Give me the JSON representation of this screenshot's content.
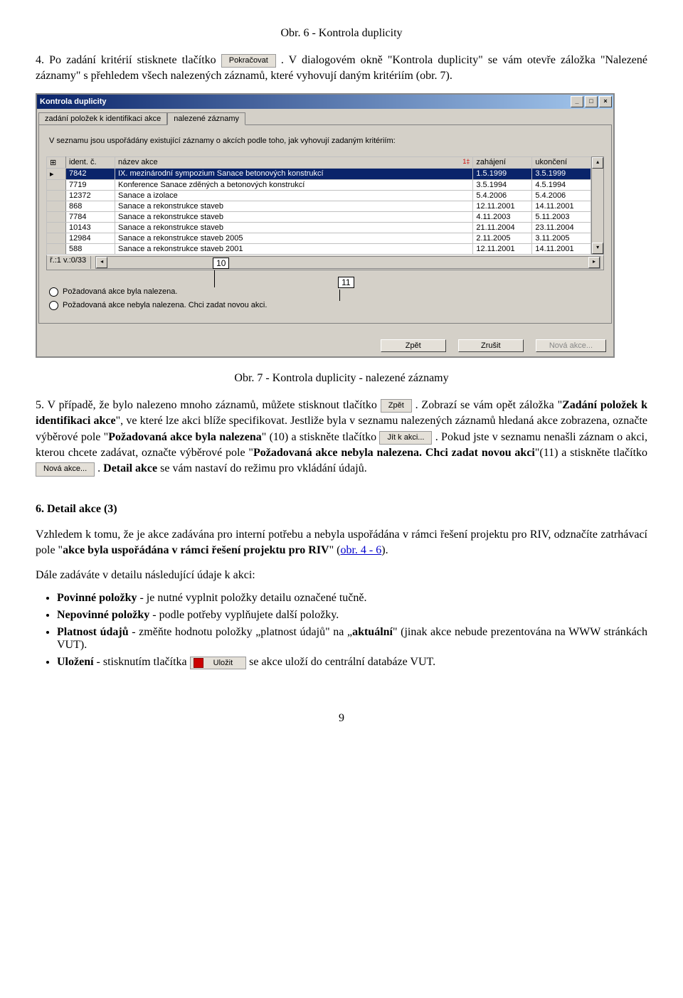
{
  "fig6_caption": "Obr. 6 - Kontrola duplicity",
  "para4_prefix": "4. Po zadání kritérií stisknete tlačítko ",
  "btn_pokracovat": "Pokračovat",
  "para4_suffix": ". V dialogovém okně \"Kontrola duplicity\" se vám otevře záložka \"Nalezené záznamy\" s přehledem všech nalezených záznamů, které vyhovují daným kritériím (obr. 7).",
  "dialog": {
    "title": "Kontrola duplicity",
    "min": "_",
    "max": "□",
    "close": "×",
    "tab1": "zadání položek k identifikaci akce",
    "tab2": "nalezené záznamy",
    "intro": "V seznamu jsou uspořádány existující záznamy o akcích podle toho, jak vyhovují zadaným kritériím:",
    "expand": "⊞",
    "headers": {
      "id": "ident. č.",
      "name": "název akce",
      "start": "zahájení",
      "end": "ukončení"
    },
    "sortmark": "1‡",
    "rows": [
      {
        "sel": "▸",
        "id": "7842",
        "name": "IX. mezinárodní sympozium Sanace betonových konstrukcí",
        "start": "1.5.1999",
        "end": "3.5.1999",
        "selected": true
      },
      {
        "sel": "",
        "id": "7719",
        "name": "Konference Sanace zděných a betonových konstrukcí",
        "start": "3.5.1994",
        "end": "4.5.1994"
      },
      {
        "sel": "",
        "id": "12372",
        "name": "Sanace a izolace",
        "start": "5.4.2006",
        "end": "5.4.2006"
      },
      {
        "sel": "",
        "id": "868",
        "name": "Sanace a rekonstrukce staveb",
        "start": "12.11.2001",
        "end": "14.11.2001"
      },
      {
        "sel": "",
        "id": "7784",
        "name": "Sanace a rekonstrukce staveb",
        "start": "4.11.2003",
        "end": "5.11.2003"
      },
      {
        "sel": "",
        "id": "10143",
        "name": "Sanace a rekonstrukce staveb",
        "start": "21.11.2004",
        "end": "23.11.2004"
      },
      {
        "sel": "",
        "id": "12984",
        "name": "Sanace a rekonstrukce staveb  2005",
        "start": "2.11.2005",
        "end": "3.11.2005"
      },
      {
        "sel": "",
        "id": "588",
        "name": "Sanace a rekonstrukce staveb 2001",
        "start": "12.11.2001",
        "end": "14.11.2001"
      }
    ],
    "status": "ř.:1 v.:0/33",
    "scroll_left": "◂",
    "scroll_right": "▸",
    "scroll_up": "▴",
    "scroll_down": "▾",
    "callout10": "10",
    "callout11": "11",
    "radio1": "Požadovaná akce byla nalezena.",
    "radio2": "Požadovaná akce nebyla nalezena. Chci zadat novou akci.",
    "btn_back": "Zpět",
    "btn_cancel": "Zrušit",
    "btn_new": "Nová akce..."
  },
  "fig7_caption": "Obr. 7 - Kontrola duplicity - nalezené záznamy",
  "para5": {
    "a": "5. V případě, že bylo nalezeno mnoho záznamů, můžete stisknout tlačítko ",
    "btn_zpet": "Zpět",
    "b": ". Zobrazí se vám opět záložka \"",
    "bold1": "Zadání položek k identifikaci akce",
    "c": "\", ve které lze akci blíže specifikovat. Jestliže byla v seznamu nalezených záznamů hledaná akce zobrazena, označte výběrové pole \"",
    "bold2": "Požadovaná akce byla nalezena",
    "d": "\" (10) a stiskněte tlačítko ",
    "btn_jit": "Jít k akci...",
    "e": ". Pokud jste v seznamu nenašli záznam o akci, kterou chcete zadávat, označte výběrové pole \"",
    "bold3": "Požadovaná akce nebyla nalezena. Chci zadat novou akci",
    "f": "\"(11) a stiskněte tlačítko ",
    "btn_nova": "Nová akce...",
    "g": ". ",
    "bold4": "Detail akce",
    "h": " se vám nastaví do režimu pro vkládání údajů."
  },
  "sec6": {
    "heading": "6. Detail akce (3)",
    "p1a": "Vzhledem k tomu, že je akce zadávána pro interní potřebu a nebyla uspořádána v rámci řešení projektu pro RIV, odznačíte zatrhávací pole \"",
    "p1b": "akce byla uspořádána v rámci řešení projektu pro RIV",
    "p1c": "\" (",
    "p1link": "obr. 4 - 6",
    "p1d": ").",
    "p2": "Dále zadáváte v detailu následující údaje k akci:",
    "li1a": "Povinné položky",
    "li1b": "  - je nutné vyplnit položky detailu označené tučně.",
    "li2a": "Nepovinné položky",
    "li2b": " - podle potřeby vyplňujete další položky.",
    "li3a": "Platnost údajů",
    "li3b": " - změňte hodnotu položky „platnost údajů\" na „",
    "li3c": "aktuální",
    "li3d": "\" (jinak akce nebude prezentována na WWW stránkách VUT).",
    "li4a": "Uložení",
    "li4b": " - stisknutím tlačítka ",
    "li4btn": "Uložit",
    "li4c": " se akce uloží do centrální databáze VUT."
  },
  "page_number": "9"
}
